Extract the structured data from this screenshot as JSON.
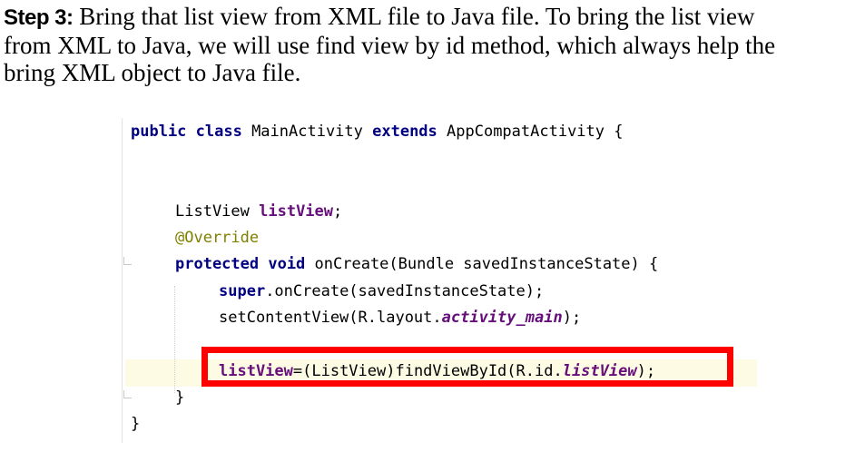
{
  "paragraph": {
    "step_label": "Step 3:",
    "line1_rest": " Bring that list view from XML file to Java file. To bring the list view",
    "line2": "from XML to Java, we will use find view by id method, which always help the",
    "line3": "bring XML object to Java file."
  },
  "code": {
    "l1_kw1": "public class",
    "l1_name": " MainActivity ",
    "l1_kw2": "extends",
    "l1_rest": " AppCompatActivity {",
    "l2_type": "ListView ",
    "l2_field": "listView",
    "l2_end": ";",
    "l3_annotation": "@Override",
    "l4_kw": "protected void",
    "l4_rest": " onCreate(Bundle savedInstanceState) {",
    "l5_kw": "super",
    "l5_rest": ".onCreate(savedInstanceState);",
    "l6_pre": "setContentView(R.layout.",
    "l6_field": "activity_main",
    "l6_end": ");",
    "l7_field": "listView",
    "l7_mid": "=(ListView)findViewById(R.id.",
    "l7_idfield": "listView",
    "l7_end": ");",
    "l8_brace": "}",
    "l9_brace": "}"
  },
  "colors": {
    "keyword": "#000080",
    "annotation": "#808000",
    "field": "#660e7a",
    "highlight_box": "#ff0000"
  }
}
